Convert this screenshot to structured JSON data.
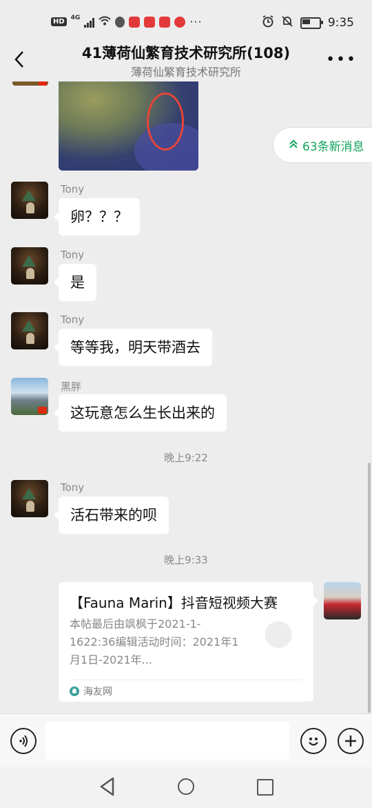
{
  "status_bar": {
    "hd_label": "HD",
    "network_label": "4G",
    "overflow_label": "···",
    "time": "9:35"
  },
  "header": {
    "title": "41薄荷仙繁育技术研究所(108)",
    "subtitle": "薄荷仙繁育技术研究所",
    "more_label": "•••"
  },
  "new_messages": {
    "label": "63条新消息"
  },
  "messages": [
    {
      "sender": "Tony",
      "text": "卵？？？"
    },
    {
      "sender": "Tony",
      "text": "是"
    },
    {
      "sender": "Tony",
      "text": "等等我，明天带酒去"
    },
    {
      "sender": "黑胖",
      "text": "这玩意怎么生长出来的"
    },
    {
      "sender": "Tony",
      "text": "活石带来的呗"
    }
  ],
  "timestamps": {
    "t1": "晚上9:22",
    "t2": "晚上9:33"
  },
  "link_card": {
    "title": "【Fauna Marin】抖音短视频大赛",
    "description": "本帖最后由飒枫于2021-1-1622:36编辑活动时间：2021年1月1日-2021年...",
    "source": "海友网"
  },
  "colors": {
    "accent_green": "#11a35a",
    "chat_background": "#ededed",
    "annotation_red": "#e8443a"
  }
}
